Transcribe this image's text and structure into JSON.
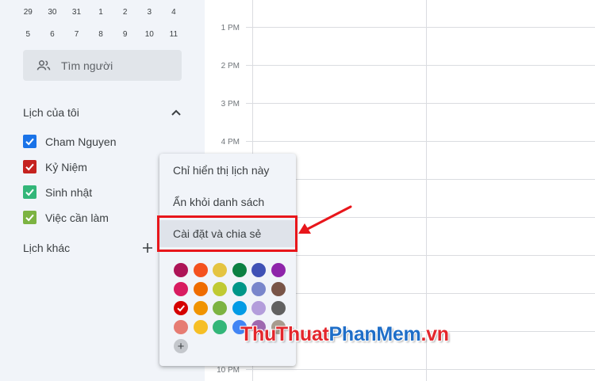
{
  "mini_calendar": {
    "row1": [
      "29",
      "30",
      "31",
      "1",
      "2",
      "3",
      "4"
    ],
    "row2": [
      "5",
      "6",
      "7",
      "8",
      "9",
      "10",
      "11"
    ]
  },
  "search": {
    "label": "Tìm người",
    "icon": "people-icon"
  },
  "my_calendars": {
    "title": "Lịch của tôi",
    "items": [
      {
        "label": "Cham Nguyen",
        "color": "#1a73e8",
        "checked": true
      },
      {
        "label": "Kỷ Niệm",
        "color": "#c5221f",
        "checked": true
      },
      {
        "label": "Sinh nhật",
        "color": "#33b679",
        "checked": true
      },
      {
        "label": "Việc cần làm",
        "color": "#7cb342",
        "checked": true
      }
    ]
  },
  "other_calendars": {
    "title": "Lịch khác"
  },
  "time_labels": [
    "1 PM",
    "2 PM",
    "3 PM",
    "4 PM",
    "10 PM"
  ],
  "menu": {
    "items": [
      "Chỉ hiển thị lịch này",
      "Ẩn khỏi danh sách",
      "Cài đặt và chia sẻ"
    ],
    "highlighted_item": "Cài đặt và chia sẻ",
    "colors": [
      [
        "#ad1457",
        "#f4511e",
        "#e4c441",
        "#0b8043",
        "#3f51b5",
        "#8e24aa"
      ],
      [
        "#d81b60",
        "#ef6c00",
        "#c0ca33",
        "#009688",
        "#7986cb",
        "#795548"
      ],
      [
        "#d50000",
        "#f09300",
        "#7cb342",
        "#039be5",
        "#b39ddb",
        "#616161"
      ],
      [
        "#e67c73",
        "#f6bf26",
        "#33b679",
        "#4285f4",
        "#9e69af",
        "#a79b8e"
      ]
    ],
    "selected_color": "#d50000"
  },
  "watermark": {
    "part1": "ThuThuat",
    "part2": "PhanMem",
    "part3": ".vn"
  }
}
